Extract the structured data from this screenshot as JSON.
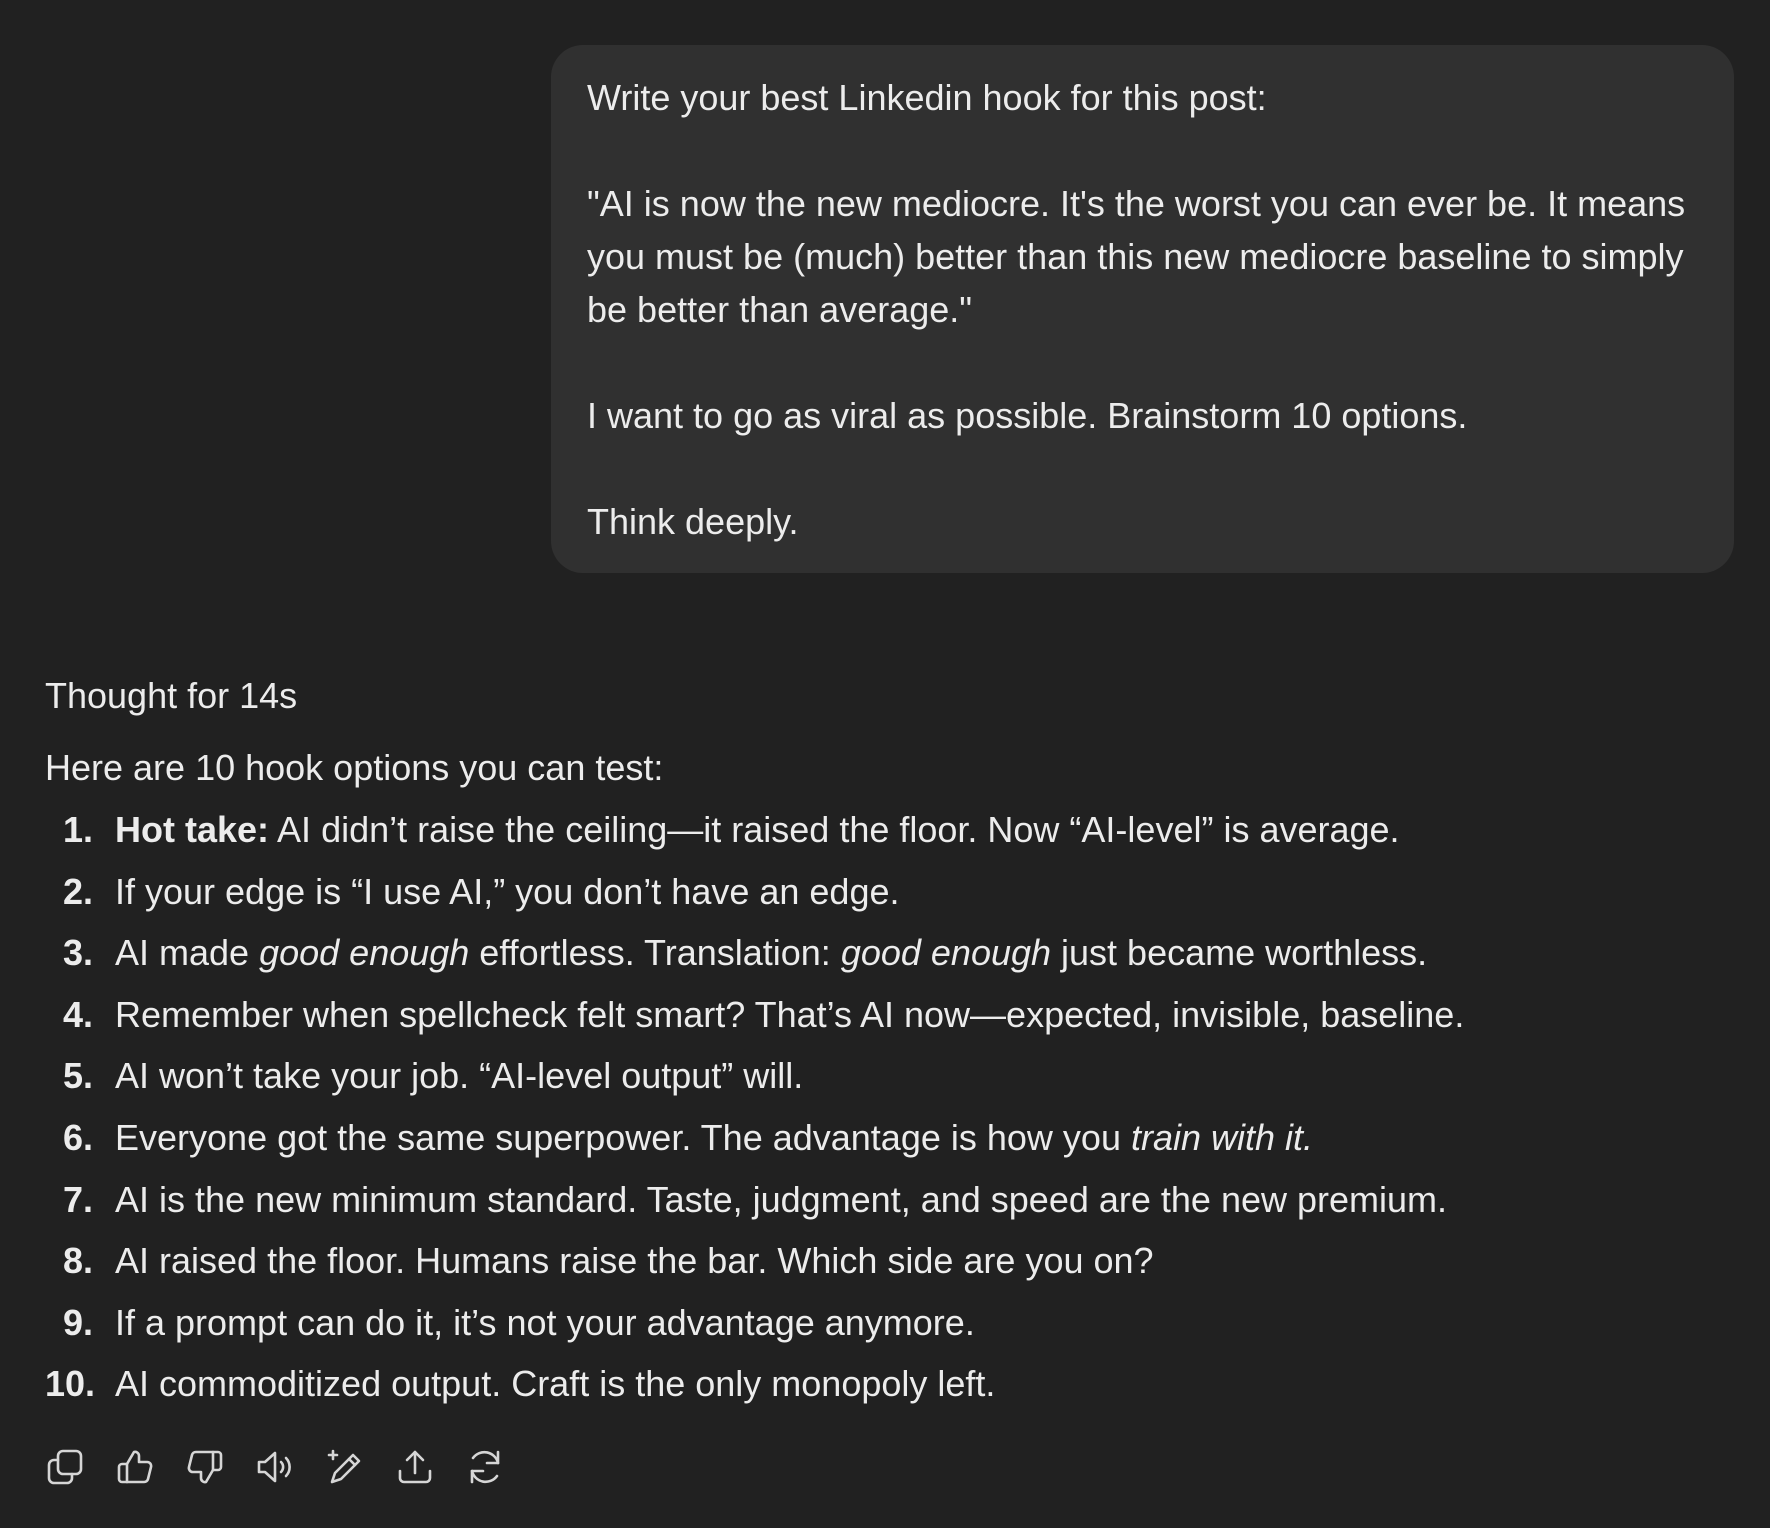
{
  "user_message": {
    "paragraphs": [
      "Write your best Linkedin hook for this post:",
      "\"AI is now the new mediocre. It's the worst you can ever be. It means you must be (much) better than this new mediocre baseline to simply be better than average.\"",
      "I want to go as viral as possible. Brainstorm 10 options.",
      "Think deeply."
    ]
  },
  "assistant": {
    "thought_label": "Thought for 14s",
    "intro": "Here are 10 hook options you can test:",
    "hooks": [
      {
        "num": "1.",
        "bold": "Hot take:",
        "t1": " AI didn’t raise the ceiling—it raised the floor. Now “AI-level” is average."
      },
      {
        "num": "2.",
        "t1": "If your edge is “I use AI,” you don’t have an edge."
      },
      {
        "num": "3.",
        "t1": "AI made ",
        "i1": "good enough",
        "t2": " effortless. Translation: ",
        "i2": "good enough",
        "t3": " just became worthless."
      },
      {
        "num": "4.",
        "t1": "Remember when spellcheck felt smart? That’s AI now—expected, invisible, baseline."
      },
      {
        "num": "5.",
        "t1": "AI won’t take your job. “AI-level output” will."
      },
      {
        "num": "6.",
        "t1": "Everyone got the same superpower. The advantage is how you ",
        "i1": "train with it."
      },
      {
        "num": "7.",
        "t1": "AI is the new minimum standard. Taste, judgment, and speed are the new premium."
      },
      {
        "num": "8.",
        "t1": "AI raised the floor. Humans raise the bar. Which side are you on?"
      },
      {
        "num": "9.",
        "t1": "If a prompt can do it, it’s not your advantage anymore."
      },
      {
        "num": "10.",
        "t1": "AI commoditized output. Craft is the only monopoly left."
      }
    ]
  },
  "actions": [
    {
      "icon": "copy-icon"
    },
    {
      "icon": "thumbs-up-icon"
    },
    {
      "icon": "thumbs-down-icon"
    },
    {
      "icon": "read-aloud-icon"
    },
    {
      "icon": "edit-sparkle-icon"
    },
    {
      "icon": "share-icon"
    },
    {
      "icon": "regenerate-icon"
    }
  ]
}
